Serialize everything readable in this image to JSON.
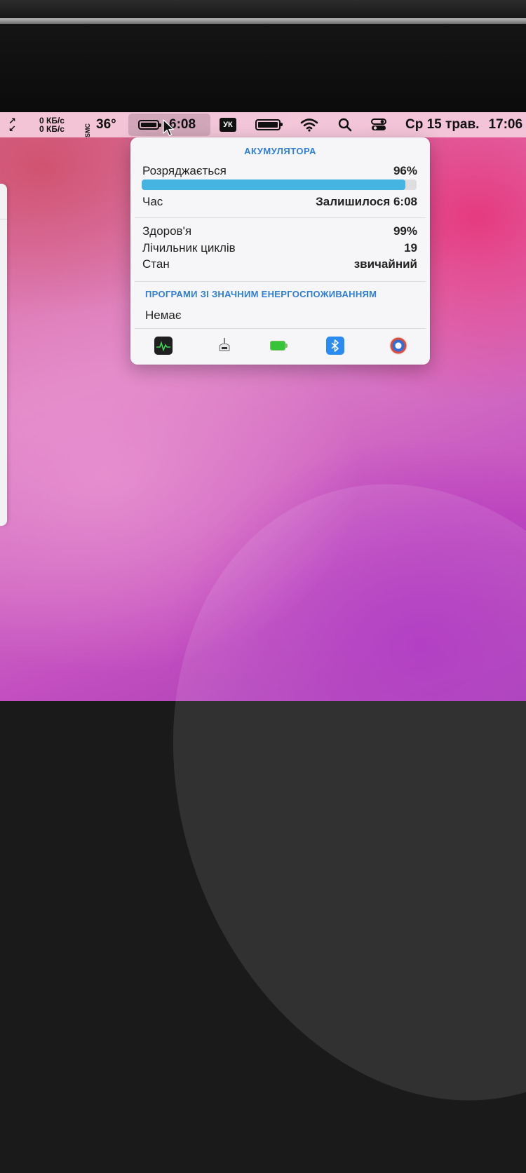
{
  "menubar": {
    "net_up": "0 КБ/с",
    "net_down": "0 КБ/с",
    "temp_icon_label": "SMC",
    "temperature": "36°",
    "battery_time": "6:08",
    "keyboard_layout": "УК",
    "day": "Ср",
    "date": "15 трав.",
    "time": "17:06"
  },
  "battery_popup": {
    "title": "АКУМУЛЯТОРА",
    "status_label": "Розряджається",
    "charge_percent": "96%",
    "charge_fraction": 0.96,
    "time_label": "Час",
    "time_value": "Залишилося 6:08",
    "health_label": "Здоров'я",
    "health_value": "99%",
    "cycles_label": "Лічильник циклів",
    "cycles_value": "19",
    "condition_label": "Стан",
    "condition_value": "звичайний",
    "energy_apps_title": "ПРОГРАМИ ЗІ ЗНАЧНИМ ЕНЕРГОСПОЖИВАННЯМ",
    "energy_apps_value": "Немає",
    "bottom_icons": [
      "activity-monitor-icon",
      "hardware-bridge-icon",
      "battery-app-icon",
      "bluetooth-icon",
      "disk-utility-icon"
    ]
  },
  "colors": {
    "accent": "#2f7fd6",
    "progress": "#45b4e0",
    "battery_app_green": "#37c43a",
    "bluetooth_blue": "#2a8cf0"
  }
}
